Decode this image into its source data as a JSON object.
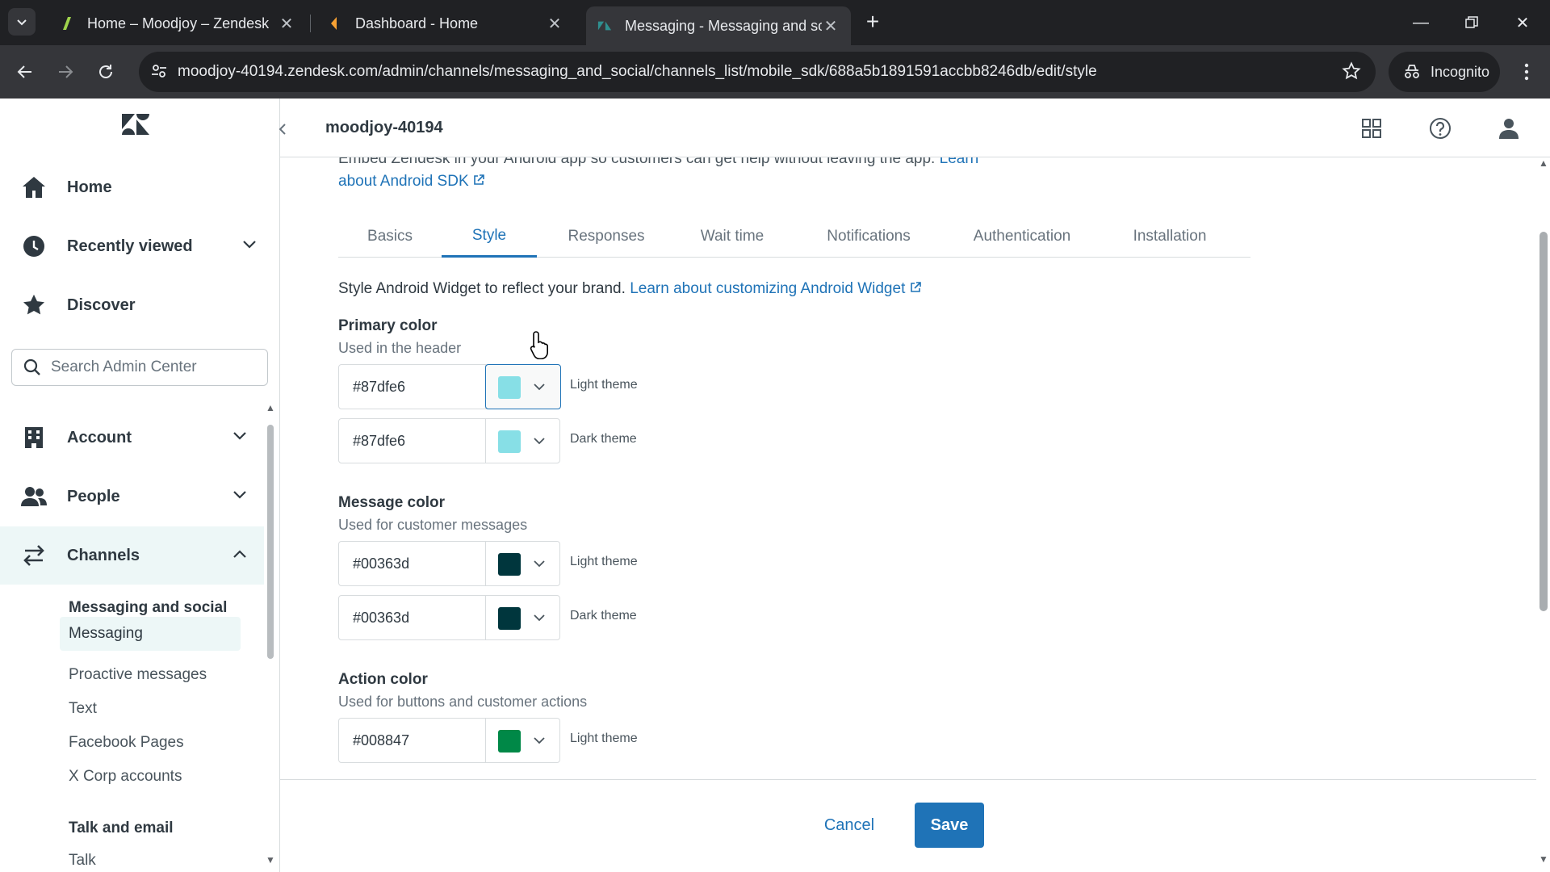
{
  "browser": {
    "tabs": [
      {
        "title": "Home – Moodjoy – Zendesk",
        "favicon": "zendesk-green-icon"
      },
      {
        "title": "Dashboard - Home",
        "favicon": "dashboard-orange-icon"
      },
      {
        "title": "Messaging - Messaging and so",
        "favicon": "zendesk-logo-icon",
        "active": true
      }
    ],
    "url": "moodjoy-40194.zendesk.com/admin/channels/messaging_and_social/channels_list/mobile_sdk/688a5b1891591accbb8246db/edit/style",
    "incognito_label": "Incognito"
  },
  "header": {
    "account": "moodjoy-40194"
  },
  "sidebar": {
    "top_items": [
      {
        "label": "Home",
        "icon": "home-icon"
      },
      {
        "label": "Recently viewed",
        "icon": "clock-icon"
      },
      {
        "label": "Discover",
        "icon": "star-icon"
      }
    ],
    "search_placeholder": "Search Admin Center",
    "items": [
      {
        "label": "Account",
        "icon": "building-icon"
      },
      {
        "label": "People",
        "icon": "people-icon"
      },
      {
        "label": "Channels",
        "icon": "channels-icon"
      }
    ],
    "subgroups": [
      {
        "heading": "Messaging and social",
        "items": [
          "Messaging",
          "Proactive messages",
          "Text",
          "Facebook Pages",
          "X Corp accounts"
        ]
      },
      {
        "heading": "Talk and email",
        "items": [
          "Talk"
        ]
      }
    ]
  },
  "content": {
    "intro_text": "Embed Zendesk in your Android app so customers can get help without leaving the app.",
    "intro_link_a": "Learn",
    "intro_link_b": "about Android SDK",
    "tabs": [
      "Basics",
      "Style",
      "Responses",
      "Wait time",
      "Notifications",
      "Authentication",
      "Installation"
    ],
    "selected_tab": "Style",
    "description": "Style Android Widget to reflect your brand.",
    "description_link": "Learn about customizing Android Widget",
    "sections": [
      {
        "title": "Primary color",
        "subtitle": "Used in the header",
        "fields": [
          {
            "hex": "#87dfe6",
            "swatch": "#87dfe6",
            "theme": "Light theme"
          },
          {
            "hex": "#87dfe6",
            "swatch": "#87dfe6",
            "theme": "Dark theme"
          }
        ]
      },
      {
        "title": "Message color",
        "subtitle": "Used for customer messages",
        "fields": [
          {
            "hex": "#00363d",
            "swatch": "#00363d",
            "theme": "Light theme"
          },
          {
            "hex": "#00363d",
            "swatch": "#00363d",
            "theme": "Dark theme"
          }
        ]
      },
      {
        "title": "Action color",
        "subtitle": "Used for buttons and customer actions",
        "fields": [
          {
            "hex": "#008847",
            "swatch": "#008847",
            "theme": "Light theme"
          }
        ]
      }
    ]
  },
  "footer": {
    "cancel_label": "Cancel",
    "save_label": "Save"
  },
  "colors": {
    "accent": "#1f73b7",
    "active_nav_bg": "#edf7f7"
  }
}
